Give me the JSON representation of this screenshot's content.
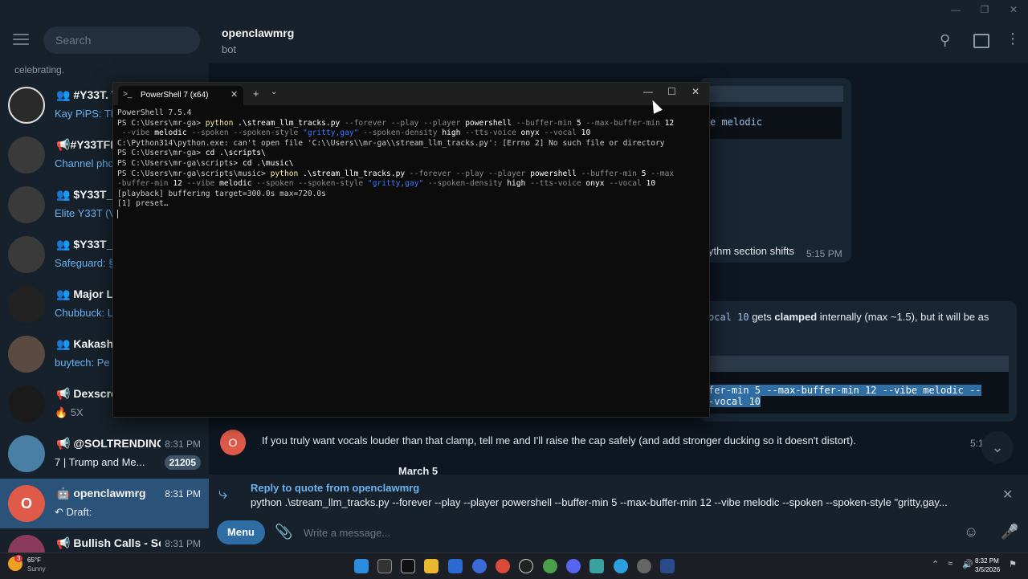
{
  "telegram": {
    "search_placeholder": "Search",
    "celebrating_text": "celebrating.",
    "chats": [
      {
        "name": "#Y33T. Th",
        "preview": "Kay PiPS: Th",
        "time": "",
        "badge": ""
      },
      {
        "name": "#Y33TFL3",
        "preview": "Channel pho",
        "time": "",
        "badge": ""
      },
      {
        "name": "$Y33T_W",
        "preview": "Elite Y33T (V",
        "time": "",
        "badge": ""
      },
      {
        "name": "$Y33T_O",
        "preview": "Safeguard: §",
        "time": "",
        "badge": ""
      },
      {
        "name": "Major Liv",
        "preview": "Chubbuck: L",
        "time": "",
        "badge": ""
      },
      {
        "name": "Kakashi H",
        "preview": "buytech: Pe",
        "time": "",
        "badge": ""
      },
      {
        "name": "Dexscree",
        "preview": "5X",
        "time": "",
        "badge": ""
      },
      {
        "name": "@SOLTRENDING...",
        "preview": "7 | Trump and Me...",
        "time": "8:31 PM",
        "badge": "21205"
      },
      {
        "name": "openclawmrg",
        "preview": "Draft:",
        "time": "8:31 PM",
        "badge": ""
      },
      {
        "name": "Bullish Calls - Sol...",
        "preview": "",
        "time": "8:31 PM",
        "badge": ""
      }
    ],
    "header": {
      "title": "openclawmrg",
      "subtitle": "bot"
    },
    "messages": {
      "code1_tail": "e melodic",
      "rhythm_text": "ythm section shifts",
      "time1": "5:15 PM",
      "clamp_code": "ocal 10",
      "clamp_text_1": "gets",
      "clamp_bold": "clamped",
      "clamp_text_2": "internally (max ~1.5), but it will be as",
      "code2_line1": "fer-min 5 --max-buffer-min 12 --vibe melodic --",
      "code2_line2": "-vocal 10",
      "last_avatar": "O",
      "last_text": "If you truly want vocals louder than that clamp, tell me and I'll raise the cap safely (and add stronger ducking so it doesn't distort).",
      "last_time": "5:1",
      "date_divider": "March 5"
    },
    "reply": {
      "title": "Reply to quote from openclawmrg",
      "text": "python .\\stream_llm_tracks.py --forever --play --player powershell --buffer-min 5 --max-buffer-min 12 --vibe melodic --spoken --spoken-style \"gritty,gay..."
    },
    "composer": {
      "menu_label": "Menu",
      "placeholder": "Write a message..."
    }
  },
  "powershell": {
    "tab_title": "PowerShell 7 (x64)",
    "version_line": "PowerShell 7.5.4",
    "lines": {
      "p1": "PS C:\\Users\\mr-ga>",
      "cmd1a": " python",
      "cmd1b": " .\\stream_llm_tracks.py",
      "cmd1c": " --forever --play --player",
      "cmd1d": " powershell",
      "cmd1e": " --buffer-min",
      "cmd1f": " 5",
      "cmd1g": " --max-buffer-min",
      "cmd1h": " 12",
      "cmd1i": " --vibe",
      "cmd1j": " melodic",
      "cmd1k": " --spoken --spoken-style",
      "cmd1l": " \"gritty,gay\"",
      "cmd1m": " --spoken-density",
      "cmd1n": " high",
      "cmd1o": " --tts-voice",
      "cmd1p": " onyx",
      "cmd1q": " --vocal",
      "cmd1r": " 10",
      "err": "C:\\Python314\\python.exe: can't open file 'C:\\\\Users\\\\mr-ga\\\\stream_llm_tracks.py': [Errno 2] No such file or directory",
      "p2": "PS C:\\Users\\mr-ga>",
      "cmd2": " cd .\\scripts\\",
      "p3": "PS C:\\Users\\mr-ga\\scripts>",
      "cmd3": " cd .\\music\\",
      "p4": "PS C:\\Users\\mr-ga\\scripts\\music>",
      "c4b": " --max",
      "c4c": "-buffer-min",
      "playback": "[playback] buffering target=300.0s max=720.0s",
      "preset": "[1] preset…"
    }
  },
  "taskbar": {
    "weather_temp": "65°F",
    "weather_cond": "Sunny",
    "weather_badge": "3",
    "time": "8:32 PM",
    "date": "3/5/2026"
  }
}
